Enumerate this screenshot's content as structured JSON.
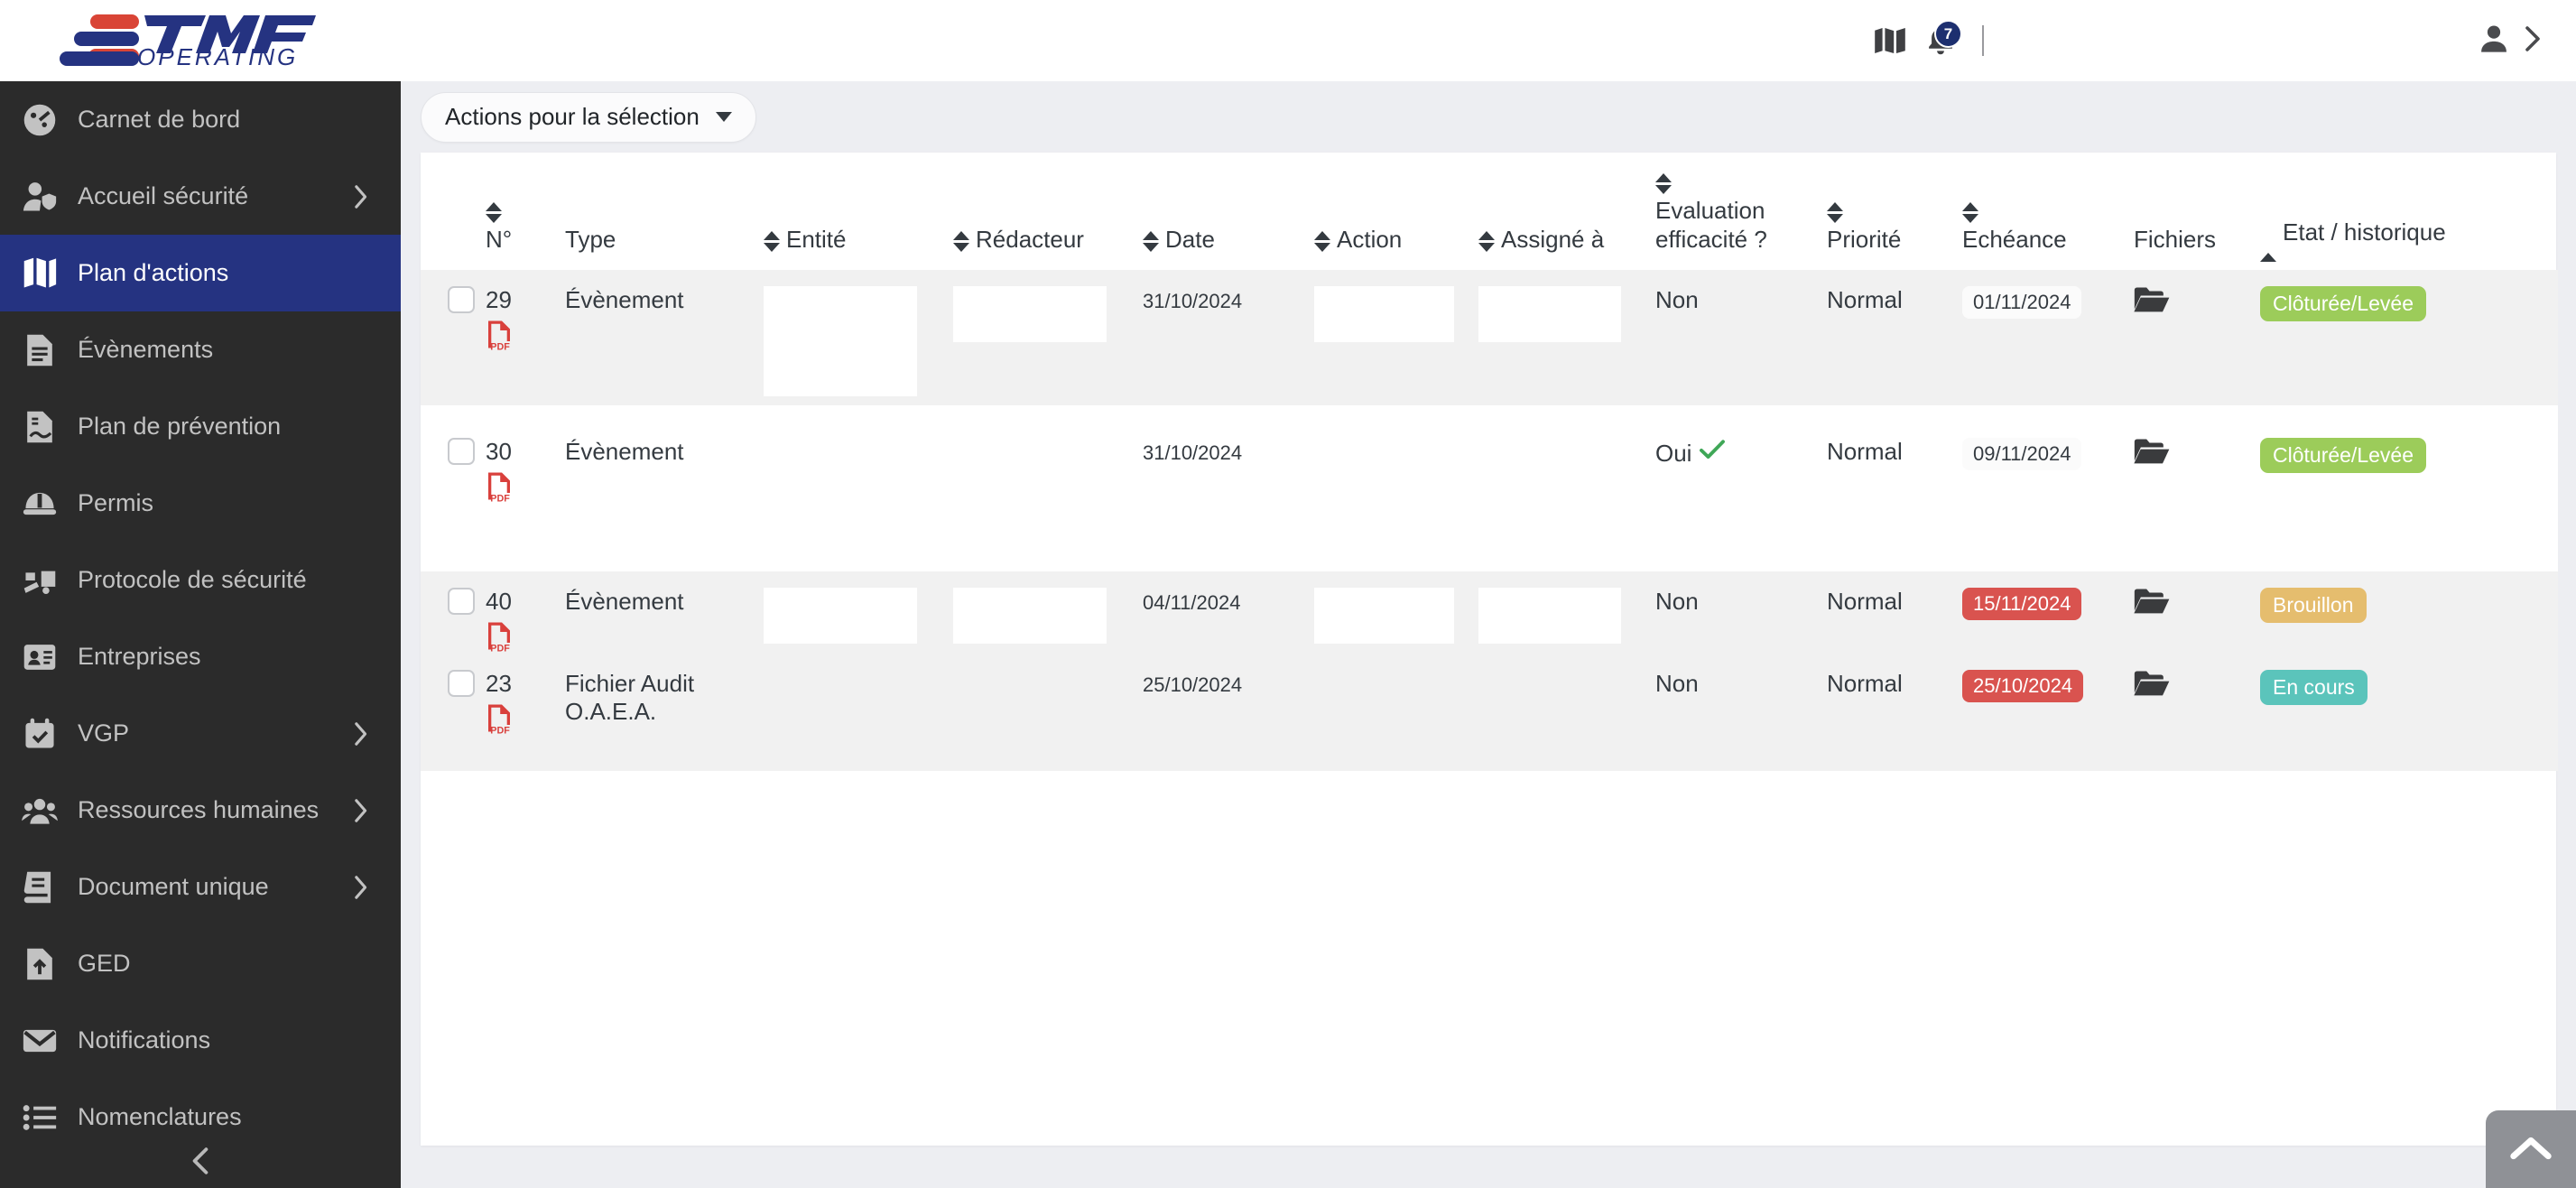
{
  "brand": {
    "name": "TMF",
    "sub": "OPERATING",
    "navy": "#253381",
    "red": "#d94436"
  },
  "topbar": {
    "map_icon": "map-icon",
    "bell_icon": "bell-icon",
    "notification_count": "7",
    "user_icon": "user-icon",
    "expand_icon": "chevron-right-icon"
  },
  "sidebar": {
    "items": [
      {
        "label": "Carnet de bord",
        "icon": "dashboard-icon",
        "active": false,
        "chevron": false
      },
      {
        "label": "Accueil sécurité",
        "icon": "user-shield-icon",
        "active": false,
        "chevron": true
      },
      {
        "label": "Plan d'actions",
        "icon": "map-book-icon",
        "active": true,
        "chevron": false
      },
      {
        "label": "Évènements",
        "icon": "document-lines-icon",
        "active": false,
        "chevron": false
      },
      {
        "label": "Plan de prévention",
        "icon": "document-signature-icon",
        "active": false,
        "chevron": false
      },
      {
        "label": "Permis",
        "icon": "helmet-icon",
        "active": false,
        "chevron": false
      },
      {
        "label": "Protocole de sécurité",
        "icon": "truck-loading-icon",
        "active": false,
        "chevron": false
      },
      {
        "label": "Entreprises",
        "icon": "id-card-icon",
        "active": false,
        "chevron": false
      },
      {
        "label": "VGP",
        "icon": "calendar-check-icon",
        "active": false,
        "chevron": true
      },
      {
        "label": "Ressources humaines",
        "icon": "users-icon",
        "active": false,
        "chevron": true
      },
      {
        "label": "Document unique",
        "icon": "book-icon",
        "active": false,
        "chevron": true
      },
      {
        "label": "GED",
        "icon": "file-upload-icon",
        "active": false,
        "chevron": false
      },
      {
        "label": "Notifications",
        "icon": "envelope-icon",
        "active": false,
        "chevron": false
      },
      {
        "label": "Nomenclatures",
        "icon": "list-icon",
        "active": false,
        "chevron": false
      }
    ],
    "collapse_icon": "chevron-left-icon"
  },
  "toolbar": {
    "bulk_actions_label": "Actions pour la sélection"
  },
  "table": {
    "columns": [
      {
        "key": "check",
        "label": "",
        "sort": "none"
      },
      {
        "key": "num",
        "label": "N°",
        "sort": "both-above"
      },
      {
        "key": "type",
        "label": "Type",
        "sort": "none"
      },
      {
        "key": "entite",
        "label": "Entité",
        "sort": "both-inline"
      },
      {
        "key": "redac",
        "label": "Rédacteur",
        "sort": "both-inline"
      },
      {
        "key": "date",
        "label": "Date",
        "sort": "both-inline"
      },
      {
        "key": "action",
        "label": "Action",
        "sort": "both-inline"
      },
      {
        "key": "assig",
        "label": "Assigné à",
        "sort": "both-inline"
      },
      {
        "key": "eval",
        "label": "Evaluation efficacité ?",
        "sort": "both-above"
      },
      {
        "key": "prio",
        "label": "Priorité",
        "sort": "both-above"
      },
      {
        "key": "eche",
        "label": "Echéance",
        "sort": "both-above"
      },
      {
        "key": "fich",
        "label": "Fichiers",
        "sort": "none"
      },
      {
        "key": "etat",
        "label": "Etat / historique",
        "sort": "asc-active"
      }
    ],
    "rows": [
      {
        "num": "29",
        "type": "Évènement",
        "file_icon": "pdf-icon",
        "entite": "",
        "redacteur": "",
        "date": "31/10/2024",
        "action": "",
        "assigne": "",
        "evaluation": "Non",
        "evaluation_check": false,
        "priorite": "Normal",
        "echeance": "01/11/2024",
        "echeance_style": "white",
        "fichiers_icon": "folder-open-icon",
        "etat": "Clôturée/Levée",
        "etat_color": "#9ccc5a",
        "shaded": true
      },
      {
        "num": "30",
        "type": "Évènement",
        "file_icon": "pdf-icon",
        "entite": "",
        "redacteur": "",
        "date": "31/10/2024",
        "action": "",
        "assigne": "",
        "evaluation": "Oui",
        "evaluation_check": true,
        "priorite": "Normal",
        "echeance": "09/11/2024",
        "echeance_style": "white",
        "fichiers_icon": "folder-open-icon",
        "etat": "Clôturée/Levée",
        "etat_color": "#9ccc5a",
        "shaded": false
      },
      {
        "num": "40",
        "type": "Évènement",
        "file_icon": "pdf-icon",
        "entite": "",
        "redacteur": "",
        "date": "04/11/2024",
        "action": "",
        "assigne": "",
        "evaluation": "Non",
        "evaluation_check": false,
        "priorite": "Normal",
        "echeance": "15/11/2024",
        "echeance_style": "red",
        "fichiers_icon": "folder-open-icon",
        "etat": "Brouillon",
        "etat_color": "#e5bd6e",
        "shaded": true
      },
      {
        "num": "23",
        "type": "Fichier Audit O.A.E.A.",
        "file_icon": "pdf-icon",
        "entite": "",
        "redacteur": "",
        "date": "25/10/2024",
        "action": "",
        "assigne": "",
        "evaluation": "Non",
        "evaluation_check": false,
        "priorite": "Normal",
        "echeance": "25/10/2024",
        "echeance_style": "red",
        "fichiers_icon": "folder-open-icon",
        "etat": "En cours",
        "etat_color": "#5bc4bb",
        "shaded": true
      }
    ]
  },
  "scroll_top": {
    "icon": "chevron-up-icon"
  }
}
